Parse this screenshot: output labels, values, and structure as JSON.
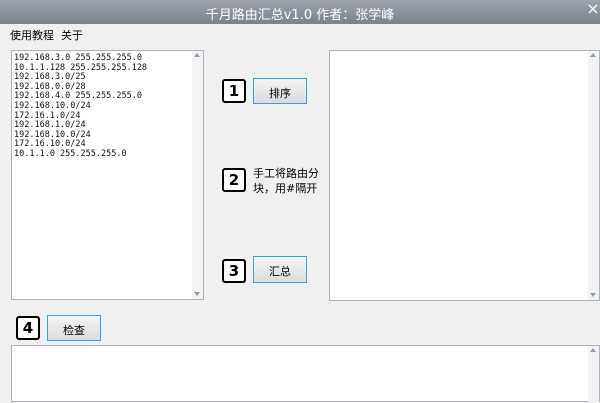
{
  "window": {
    "title": "千月路由汇总v1.0   作者：张学峰",
    "close_glyph": "×"
  },
  "menu": [
    {
      "label": "使用教程"
    },
    {
      "label": "关于"
    }
  ],
  "input_box": {
    "routes": [
      "192.168.3.0 255.255.255.0",
      "10.1.1.128 255.255.255.128",
      "192.168.3.0/25",
      "192.168.0.0/28",
      "192.168.4.0 255.255.255.0",
      "192.168.10.0/24",
      "172.16.1.0/24",
      "192.168.1.0/24",
      "192.168.10.0/24",
      "172.16.10.0/24",
      "10.1.1.0 255.255.255.0"
    ]
  },
  "steps": {
    "one": {
      "num": "1",
      "button": "排序"
    },
    "two": {
      "num": "2",
      "note_line1": "手工将路由分",
      "note_line2": "块，用#隔开"
    },
    "three": {
      "num": "3",
      "button": "汇总"
    },
    "four": {
      "num": "4",
      "button": "检查"
    }
  }
}
